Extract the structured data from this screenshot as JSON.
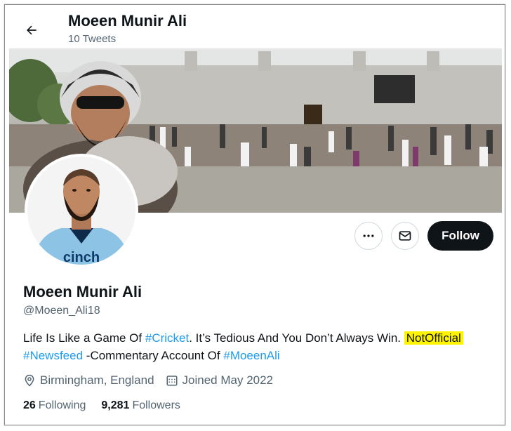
{
  "header": {
    "name": "Moeen Munir Ali",
    "tweet_count": "10 Tweets"
  },
  "icons": {
    "back": "arrow-left-icon",
    "more": "more-dots-icon",
    "message": "envelope-icon",
    "location": "location-pin-icon",
    "calendar": "calendar-icon"
  },
  "actions": {
    "follow_label": "Follow"
  },
  "profile": {
    "name": "Moeen Munir Ali",
    "handle": "@Moeen_Ali18",
    "bio": {
      "part1": "Life Is Like a Game Of ",
      "tag1": "#Cricket",
      "part2": ". It’s Tedious And You Don’t Always Win. ",
      "highlight": "NotOfficial",
      "tag2": "#Newsfeed",
      "part3": " -Commentary Account Of ",
      "tag3": "#MoeenAli"
    },
    "location": "Birmingham, England",
    "joined": "Joined May 2022",
    "following_count": "26",
    "following_label": "Following",
    "followers_count": "9,281",
    "followers_label": "Followers"
  },
  "colors": {
    "accent": "#1d9bf0",
    "highlight": "#fff400",
    "follow_bg": "#0f1419"
  }
}
